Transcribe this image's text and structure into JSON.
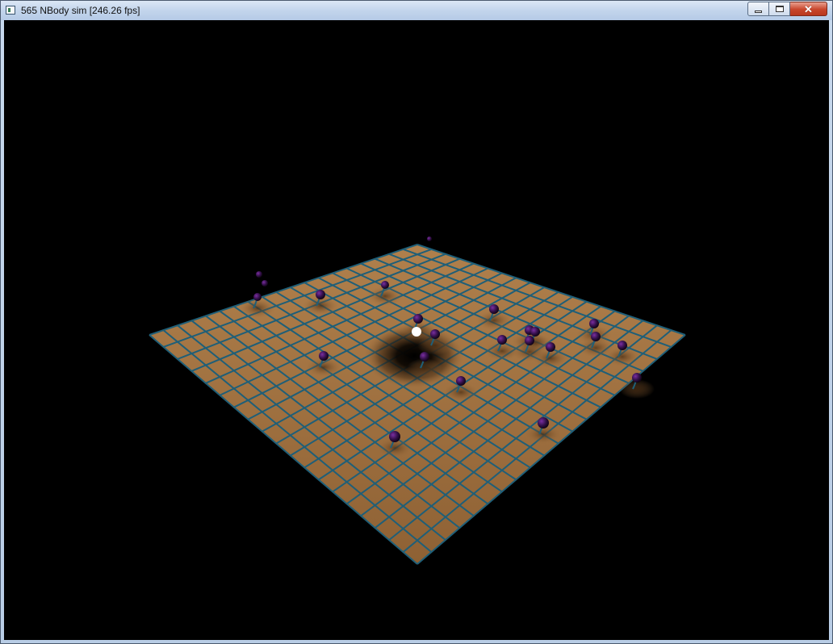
{
  "window": {
    "title": "565 NBody sim [246.26 fps]",
    "minimize_icon": "minimize-icon",
    "maximize_icon": "maximize-icon",
    "close_icon": "close-icon",
    "close_glyph": "✕"
  },
  "scene": {
    "background_color": "#000000",
    "plane_color": "#9a6a3b",
    "grid_color": "#1f5f78",
    "body_color": "#3a0f4f",
    "central_body_color": "#ffffff"
  }
}
